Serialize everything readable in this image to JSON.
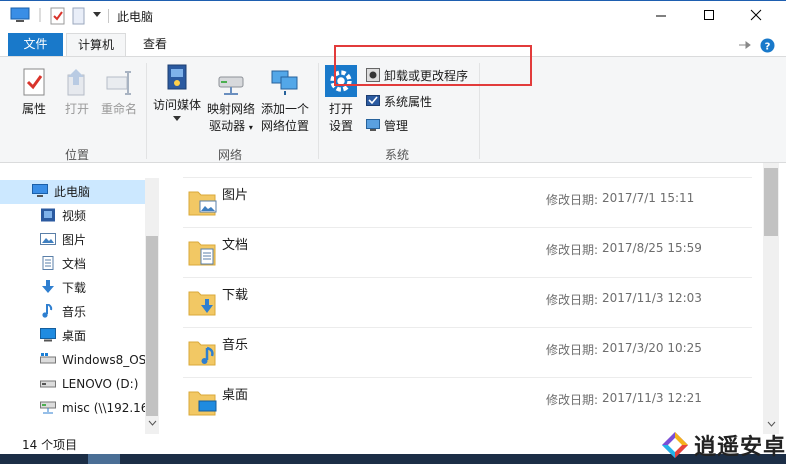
{
  "window": {
    "title": "此电脑"
  },
  "tabs": {
    "file": "文件",
    "computer": "计算机",
    "view": "查看"
  },
  "ribbon": {
    "location_group": {
      "label": "位置",
      "properties": "属性",
      "open": "打开",
      "rename": "重命名"
    },
    "network_group": {
      "label": "网络",
      "access_media": "访问媒体",
      "map_drive_line1": "映射网络",
      "map_drive_line2": "驱动器",
      "add_location_line1": "添加一个",
      "add_location_line2": "网络位置"
    },
    "system_group": {
      "label": "系统",
      "open_settings_line1": "打开",
      "open_settings_line2": "设置",
      "uninstall": "卸载或更改程序",
      "system_properties": "系统属性",
      "manage": "管理"
    }
  },
  "nav": {
    "items": [
      {
        "label": "此电脑",
        "icon": "computer-icon"
      },
      {
        "label": "视频",
        "icon": "video-icon"
      },
      {
        "label": "图片",
        "icon": "pictures-icon"
      },
      {
        "label": "文档",
        "icon": "documents-icon"
      },
      {
        "label": "下载",
        "icon": "download-icon"
      },
      {
        "label": "音乐",
        "icon": "music-icon"
      },
      {
        "label": "桌面",
        "icon": "desktop-icon"
      },
      {
        "label": "Windows8_OS",
        "icon": "drive-icon"
      },
      {
        "label": "LENOVO (D:)",
        "icon": "drive-icon"
      },
      {
        "label": "misc (\\\\192.16",
        "icon": "network-drive-icon"
      }
    ]
  },
  "content": {
    "modified_label": "修改日期:",
    "folders": [
      {
        "name": "图片",
        "modified": "2017/7/1 15:11"
      },
      {
        "name": "文档",
        "modified": "2017/8/25 15:59"
      },
      {
        "name": "下载",
        "modified": "2017/11/3 12:03"
      },
      {
        "name": "音乐",
        "modified": "2017/3/20 10:25"
      },
      {
        "name": "桌面",
        "modified": "2017/11/3 12:21"
      }
    ]
  },
  "status": {
    "item_count": "14 个项目"
  },
  "watermark": {
    "text": "逍遥安卓"
  },
  "colors": {
    "accent": "#1979ca",
    "highlight": "#e23b3b",
    "selected": "#cce8ff"
  }
}
